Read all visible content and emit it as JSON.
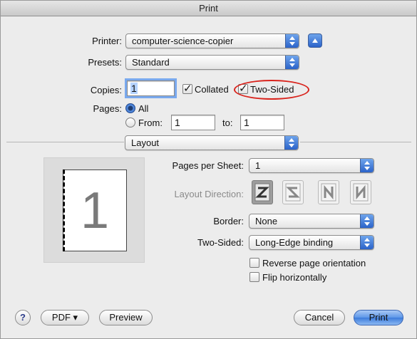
{
  "window": {
    "title": "Print"
  },
  "printer": {
    "label": "Printer:",
    "value": "computer-science-copier"
  },
  "presets": {
    "label": "Presets:",
    "value": "Standard"
  },
  "copies": {
    "label": "Copies:",
    "value": "1",
    "collated_label": "Collated",
    "collated_checked": true,
    "two_sided_label": "Two-Sided",
    "two_sided_checked": true
  },
  "pages": {
    "label": "Pages:",
    "all_label": "All",
    "from_label": "From:",
    "from_value": "1",
    "to_label": "to:",
    "to_value": "1"
  },
  "section": {
    "value": "Layout"
  },
  "preview": {
    "page_number": "1"
  },
  "layout": {
    "pages_per_sheet_label": "Pages per Sheet:",
    "pages_per_sheet_value": "1",
    "direction_label": "Layout Direction:",
    "border_label": "Border:",
    "border_value": "None",
    "two_sided_label": "Two-Sided:",
    "two_sided_value": "Long-Edge binding",
    "reverse_label": "Reverse page orientation",
    "reverse_checked": false,
    "flip_label": "Flip horizontally",
    "flip_checked": false
  },
  "buttons": {
    "help": "?",
    "pdf": "PDF ▾",
    "preview": "Preview",
    "cancel": "Cancel",
    "print": "Print"
  },
  "colors": {
    "accent": "#3d7cdb",
    "highlight": "#d9241d"
  }
}
